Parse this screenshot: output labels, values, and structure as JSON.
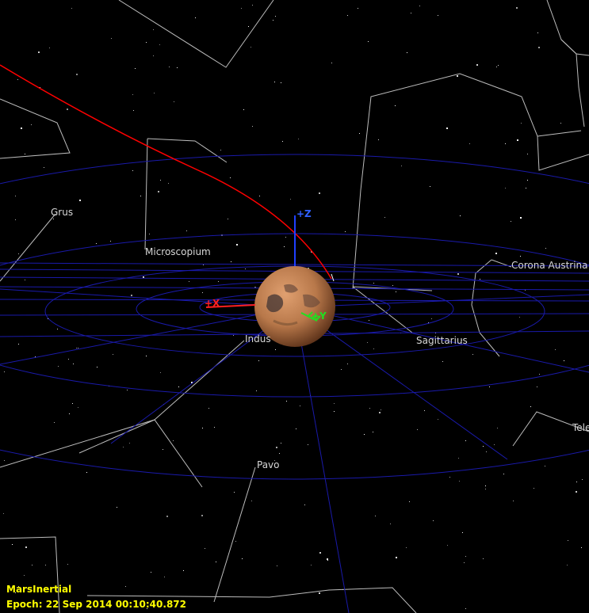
{
  "view": {
    "frame": "MarsInertial",
    "epoch_label": "Epoch:",
    "epoch_value": "22 Sep 2014 00:10:40.872"
  },
  "constellations": [
    "Grus",
    "Microscopium",
    "Indus",
    "Sagittarius",
    "Corona Austrina",
    "Pavo",
    "Tele"
  ],
  "axes": {
    "x": "+X",
    "y": "+Y",
    "z": "+Z"
  },
  "colors": {
    "background": "#000000",
    "grid": "#1a1aaa",
    "constellation_lines": "#bdbdbd",
    "trajectory": "#ff0000",
    "x_axis": "#ff2020",
    "y_axis": "#20e020",
    "z_axis": "#2040ff",
    "overlay_text": "#ffff00",
    "planet": "#b8784a"
  },
  "icons": {
    "planet": "mars-globe-icon"
  }
}
